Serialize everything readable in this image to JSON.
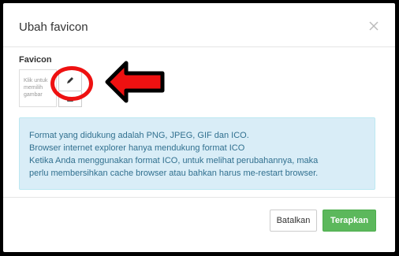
{
  "modal": {
    "title": "Ubah favicon"
  },
  "favicon": {
    "label": "Favicon",
    "hint": "Klik untuk\nmemilih\ngambar"
  },
  "info": {
    "lines": [
      "Format yang didukung adalah PNG, JPEG, GIF dan ICO.",
      "Browser internet explorer hanya mendukung format ICO",
      "Ketika Anda menggunakan format ICO, untuk melihat perubahannya, maka",
      "perlu membersihkan cache browser atau bahkan harus me-restart browser."
    ]
  },
  "footer": {
    "cancel_label": "Batalkan",
    "apply_label": "Terapkan"
  },
  "colors": {
    "annotation": "#e11",
    "apply_button": "#5cb85c",
    "info_text": "#31708f",
    "info_bg": "#d9edf7"
  },
  "icons": {
    "close": "close-icon",
    "edit": "pencil-icon"
  }
}
